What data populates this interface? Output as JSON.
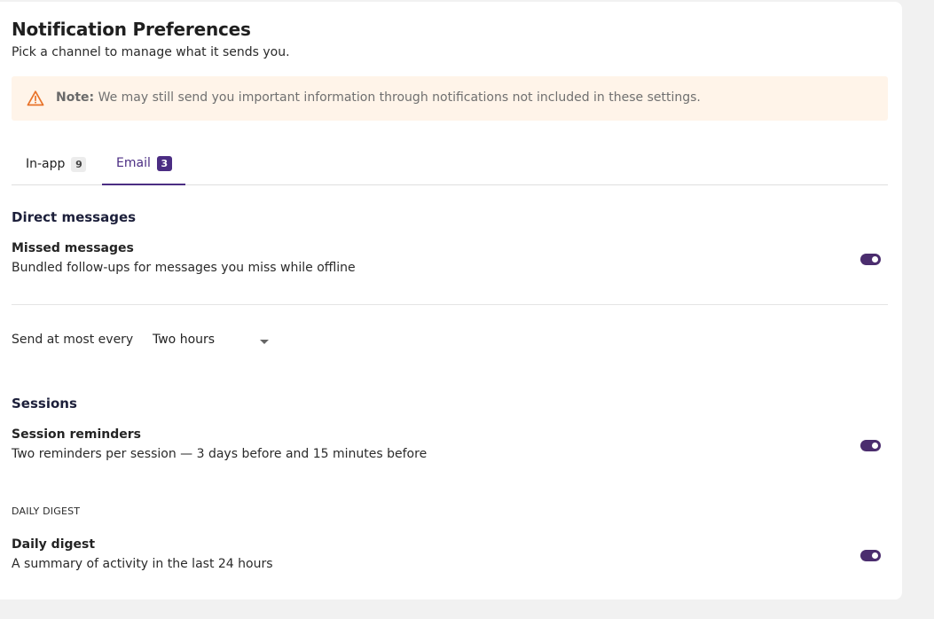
{
  "header": {
    "title": "Notification Preferences",
    "subtitle": "Pick a channel to manage what it sends you."
  },
  "note": {
    "icon": "warning-triangle-icon",
    "label": "Note:",
    "text": "We may still send you important information through notifications not included in these settings."
  },
  "tabs": [
    {
      "label": "In-app",
      "count": "9",
      "active": false
    },
    {
      "label": "Email",
      "count": "3",
      "active": true
    }
  ],
  "direct_messages": {
    "title": "Direct messages",
    "missed": {
      "title": "Missed messages",
      "description": "Bundled follow-ups for messages you miss while offline",
      "enabled": true
    },
    "frequency": {
      "label": "Send at most every",
      "value": "Two hours"
    }
  },
  "sessions": {
    "title": "Sessions",
    "reminders": {
      "title": "Session reminders",
      "description": "Two reminders per session — 3 days before and 15 minutes before",
      "enabled": true
    }
  },
  "daily_digest": {
    "overline": "DAILY DIGEST",
    "title": "Daily digest",
    "description": "A summary of activity in the last 24 hours",
    "enabled": true
  },
  "colors": {
    "accent": "#4b2d83",
    "toggle_on": "#4b2d6e",
    "note_background": "#fff4e9",
    "warning": "#e8732a"
  }
}
